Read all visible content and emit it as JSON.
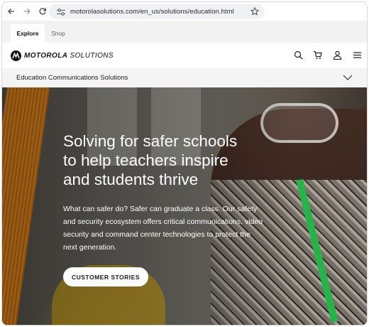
{
  "browser": {
    "url": "motorolasolutions.com/en_us/solutions/education.html",
    "icons": [
      "back-arrow-icon",
      "forward-arrow-icon",
      "reload-icon",
      "site-settings-icon",
      "bookmark-star-icon"
    ]
  },
  "site_tabs": [
    {
      "label": "Explore",
      "active": true
    },
    {
      "label": "Shop",
      "active": false
    }
  ],
  "header": {
    "logo_bold": "MOTOROLA",
    "logo_light": "SOLUTIONS",
    "icons": [
      "search-icon",
      "cart-icon",
      "user-icon",
      "menu-icon"
    ]
  },
  "section": {
    "title": "Education Communications Solutions"
  },
  "hero": {
    "heading_lines": [
      "Solving for safer schools",
      "to help teachers inspire",
      "and students thrive"
    ],
    "body": "What can safer do? Safer can graduate a class. Our safety and security ecosystem offers critical communications, video security and command center technologies to protect the next generation.",
    "cta_label": "CUSTOMER STORIES"
  },
  "colors": {
    "accent_orange": "#e98a1e",
    "lanyard_green": "#28b24a",
    "section_bar": "#f4f4f4"
  }
}
